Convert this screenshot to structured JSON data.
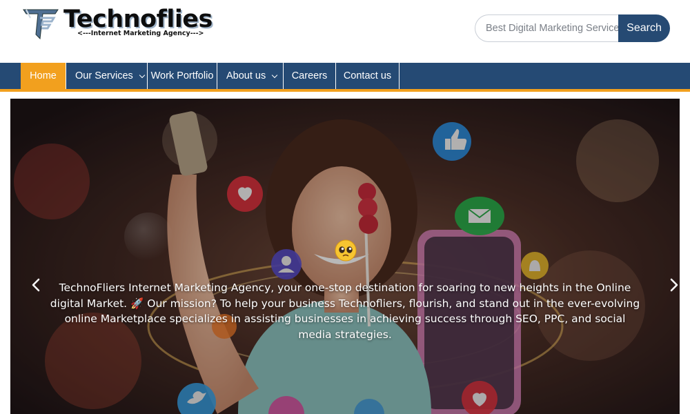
{
  "header": {
    "logo": {
      "title": "Technoflies",
      "tagline": "<---Internet Marketing Agency--->",
      "icon": "tf-logo-icon"
    },
    "search": {
      "placeholder": "Best Digital Marketing Services...",
      "value": "",
      "button_label": "Search"
    }
  },
  "nav": {
    "items": [
      {
        "label": "Home",
        "active": true,
        "dropdown": false
      },
      {
        "label": "Our Services",
        "active": false,
        "dropdown": true
      },
      {
        "label": "Work Portfolio",
        "active": false,
        "dropdown": false
      },
      {
        "label": "About us",
        "active": false,
        "dropdown": true
      },
      {
        "label": "Careers",
        "active": false,
        "dropdown": false
      },
      {
        "label": "Contact us",
        "active": false,
        "dropdown": false
      }
    ]
  },
  "hero": {
    "caption": "TechnoFliers Internet Marketing Agency, your one-stop destination for soaring to new heights in the Online digital Market. 🚀 Our mission? To help your business Technofliers, flourish, and stand out in the ever-evolving online Marketplace specializes in assisting businesses in achieving success through SEO, PPC, and social media strategies.",
    "prev_icon": "chevron-left-icon",
    "next_icon": "chevron-right-icon"
  },
  "colors": {
    "brand_blue": "#254a74",
    "accent_orange": "#f2a01e",
    "search_button": "#264a73"
  }
}
